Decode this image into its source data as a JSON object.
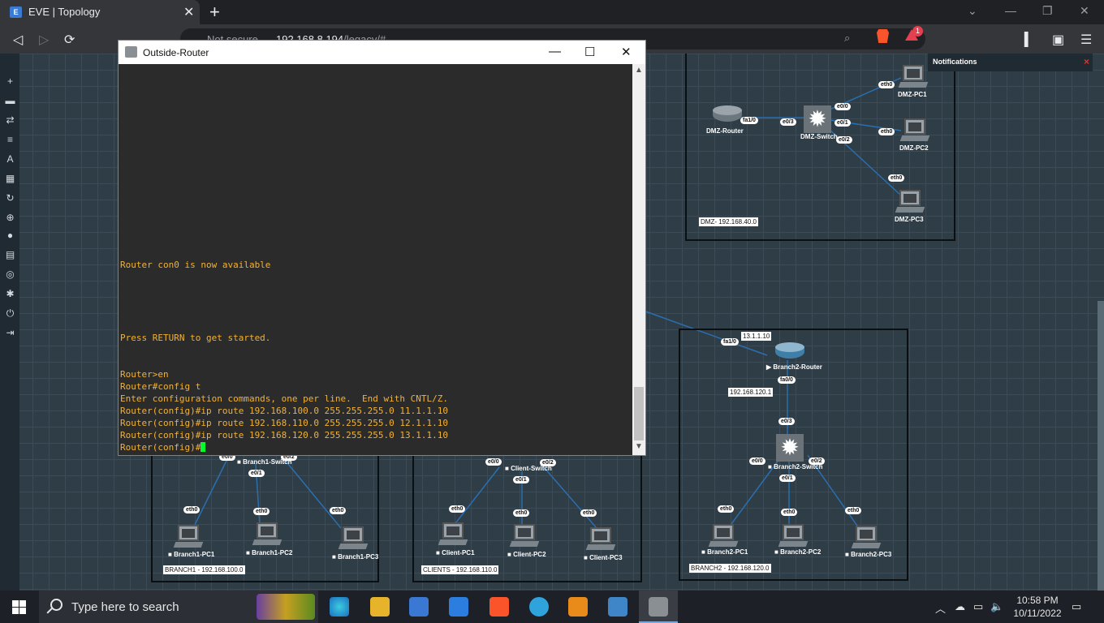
{
  "browser": {
    "tab_title": "EVE | Topology",
    "tab_close": "✕",
    "new_tab": "+",
    "security_label": "Not secure",
    "url_host": "192.168.8.194",
    "url_path": "/legacy/#",
    "shields_badge": "1"
  },
  "notifications": {
    "title": "Notifications",
    "close": "×"
  },
  "terminal": {
    "title": "Outside-Router",
    "lines": [
      "",
      "",
      "",
      "",
      "",
      "",
      "",
      "",
      "",
      "",
      "",
      "",
      "",
      "",
      "",
      "",
      "Router con0 is now available",
      "",
      "",
      "",
      "",
      "",
      "Press RETURN to get started.",
      "",
      "",
      "Router>en",
      "Router#config t",
      "Enter configuration commands, one per line.  End with CNTL/Z.",
      "Router(config)#ip route 192.168.100.0 255.255.255.0 11.1.1.10",
      "Router(config)#ip route 192.168.110.0 255.255.255.0 12.1.1.10",
      "Router(config)#ip route 192.168.120.0 255.255.255.0 13.1.1.10"
    ],
    "prompt": "Router(config)#"
  },
  "topology": {
    "dmz": {
      "box_label": "DMZ- 192.168.40.0",
      "router": "DMZ-Router",
      "switch": "DMZ-Switch",
      "pc1": "DMZ-PC1",
      "pc2": "DMZ-PC2",
      "pc3": "DMZ-PC3",
      "if_router": "fa1/0",
      "if_sw_e03": "e0/3",
      "if_sw_e00": "e0/0",
      "if_sw_e01": "e0/1",
      "if_sw_e02": "e0/2",
      "if_pc": "eth0"
    },
    "branch2": {
      "box_label": "BRANCH2 - 192.168.120.0",
      "router": "Branch2-Router",
      "switch": "Branch2-Switch",
      "pc1": "Branch2-PC1",
      "pc2": "Branch2-PC2",
      "pc3": "Branch2-PC3",
      "wan_ip": "13.1.1.10",
      "lan_ip": "192.168.120.1",
      "if_wan": "fa1/0",
      "if_lan": "fa0/0",
      "if_sw_up": "e0/3",
      "if_sw_e00": "e0/0",
      "if_sw_e01": "e0/1",
      "if_sw_e02": "e0/2",
      "if_pc": "eth0"
    },
    "branch1": {
      "box_label": "BRANCH1 - 192.168.100.0",
      "switch": "Branch1-Switch",
      "pc1": "Branch1-PC1",
      "pc2": "Branch1-PC2",
      "pc3": "Branch1-PC3",
      "if_sw_e00": "e0/0",
      "if_sw_e01": "e0/1",
      "if_sw_e02": "e0/2",
      "if_pc": "eth0"
    },
    "clients": {
      "box_label": "CLIENTS - 192.168.110.0",
      "switch": "Client-Switch",
      "pc1": "Client-PC1",
      "pc2": "Client-PC2",
      "pc3": "Client-PC3",
      "if_sw_e00": "e0/0",
      "if_sw_e01": "e0/1",
      "if_sw_e02": "e0/2",
      "if_pc": "eth0"
    }
  },
  "taskbar": {
    "search_placeholder": "Type here to search",
    "time": "10:58 PM",
    "date": "10/11/2022"
  }
}
